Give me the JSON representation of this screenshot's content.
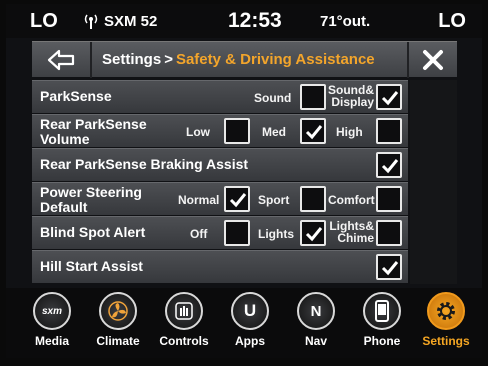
{
  "status_bar": {
    "left_temp": "LO",
    "right_temp": "LO",
    "station": "SXM 52",
    "time": "12:53",
    "outside_temp": "71°out."
  },
  "header": {
    "back_icon": "back-arrow-icon",
    "breadcrumb_root": "Settings",
    "breadcrumb_sep": ">",
    "breadcrumb_current": "Safety & Driving Assistance",
    "current_color": "#f3a52b",
    "close_icon": "close-x-icon"
  },
  "settings": {
    "parksense": {
      "label": "ParkSense",
      "opt_sound": "Sound",
      "sound_checked": false,
      "opt_sound_display_1": "Sound&",
      "opt_sound_display_2": "Display",
      "sound_display_checked": true
    },
    "rear_volume": {
      "label_1": "Rear ParkSense",
      "label_2": "Volume",
      "opt_low": "Low",
      "low_checked": false,
      "opt_med": "Med",
      "med_checked": true,
      "opt_high": "High",
      "high_checked": false
    },
    "braking_assist": {
      "label": "Rear ParkSense Braking Assist",
      "checked": true
    },
    "power_steering": {
      "label_1": "Power Steering",
      "label_2": "Default",
      "opt_normal": "Normal",
      "normal_checked": true,
      "opt_sport": "Sport",
      "sport_checked": false,
      "opt_comfort": "Comfort",
      "comfort_checked": false
    },
    "blind_spot": {
      "label": "Blind Spot Alert",
      "opt_off": "Off",
      "off_checked": false,
      "opt_lights": "Lights",
      "lights_checked": true,
      "opt_lights_chime_1": "Lights&",
      "opt_lights_chime_2": "Chime",
      "lights_chime_checked": false
    },
    "hill_start": {
      "label": "Hill Start Assist",
      "checked": true
    }
  },
  "nav": {
    "items": [
      {
        "label": "Media",
        "icon": "sxm-media-icon",
        "active": false
      },
      {
        "label": "Climate",
        "icon": "climate-fan-icon",
        "active": false
      },
      {
        "label": "Controls",
        "icon": "controls-hand-icon",
        "active": false
      },
      {
        "label": "Apps",
        "icon": "apps-icon",
        "active": false
      },
      {
        "label": "Nav",
        "icon": "compass-nav-icon",
        "active": false
      },
      {
        "label": "Phone",
        "icon": "phone-icon",
        "active": false
      },
      {
        "label": "Settings",
        "icon": "settings-gear-icon",
        "active": true
      }
    ],
    "apps_glyph": "U",
    "nav_glyph": "N",
    "media_glyph": "sxm",
    "accent": "#f5a623"
  }
}
